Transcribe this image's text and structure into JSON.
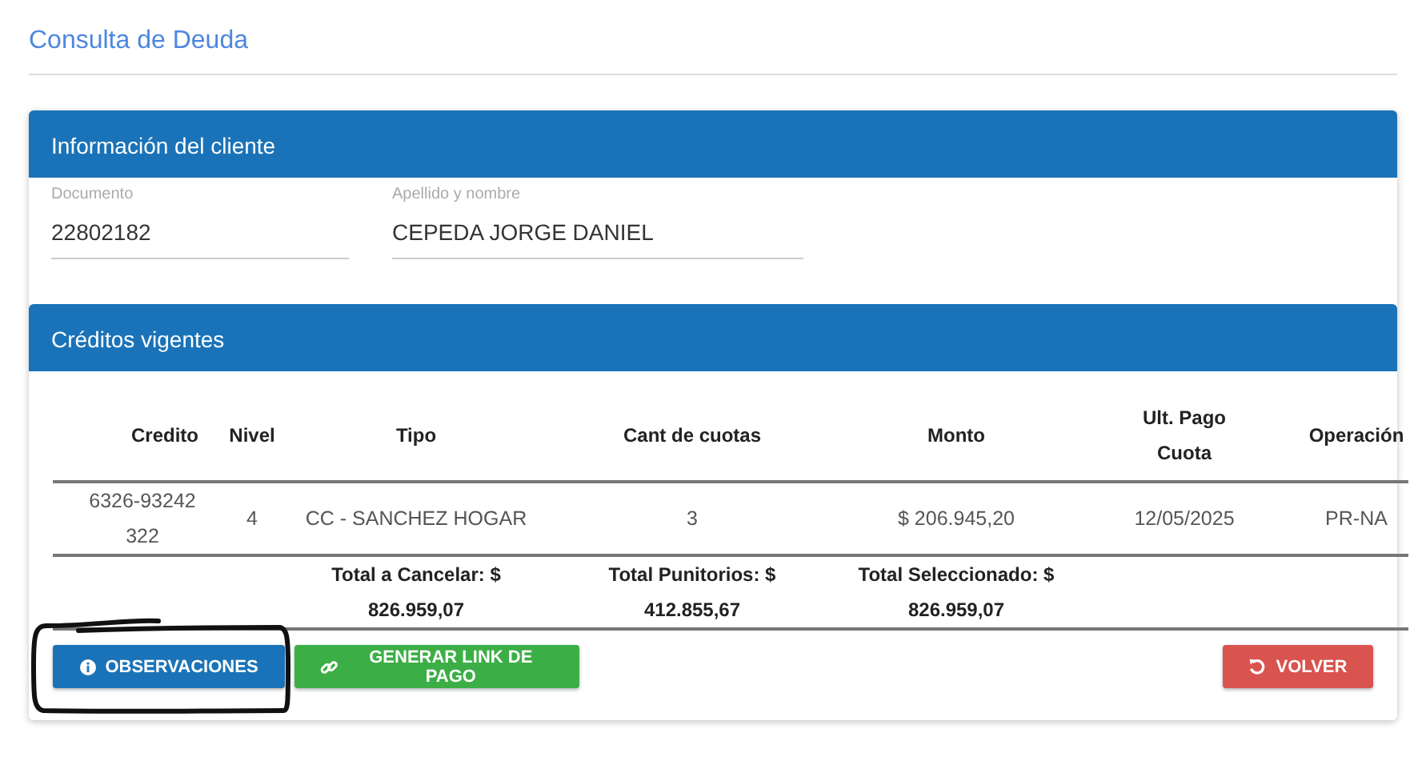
{
  "page_title": "Consulta de Deuda",
  "client": {
    "title": "Información del cliente",
    "fields": [
      {
        "label": "Documento",
        "value": "22802182"
      },
      {
        "label": "Apellido y nombre",
        "value": "CEPEDA JORGE DANIEL"
      }
    ]
  },
  "credits": {
    "title": "Créditos vigentes",
    "columns": [
      "Credito",
      "Nivel",
      "Tipo",
      "Cant de cuotas",
      "Monto",
      "Ult. Pago Cuota",
      "Operación"
    ],
    "rows": [
      [
        "6326-93242322",
        "4",
        "CC - SANCHEZ HOGAR",
        "3",
        "$ 206.945,20",
        "12/05/2025",
        "PR-NA"
      ]
    ],
    "totals": [
      {
        "label": "Total a Cancelar: $",
        "value": "826.959,07"
      },
      {
        "label": "Total Punitorios: $",
        "value": "412.855,67"
      },
      {
        "label": "Total Seleccionado: $",
        "value": "826.959,07"
      }
    ]
  },
  "buttons": [
    {
      "label": "OBSERVACIONES",
      "kind": "info"
    },
    {
      "label": "GENERAR LINK DE PAGO",
      "kind": "link"
    },
    {
      "label": "VOLVER",
      "kind": "back"
    }
  ]
}
